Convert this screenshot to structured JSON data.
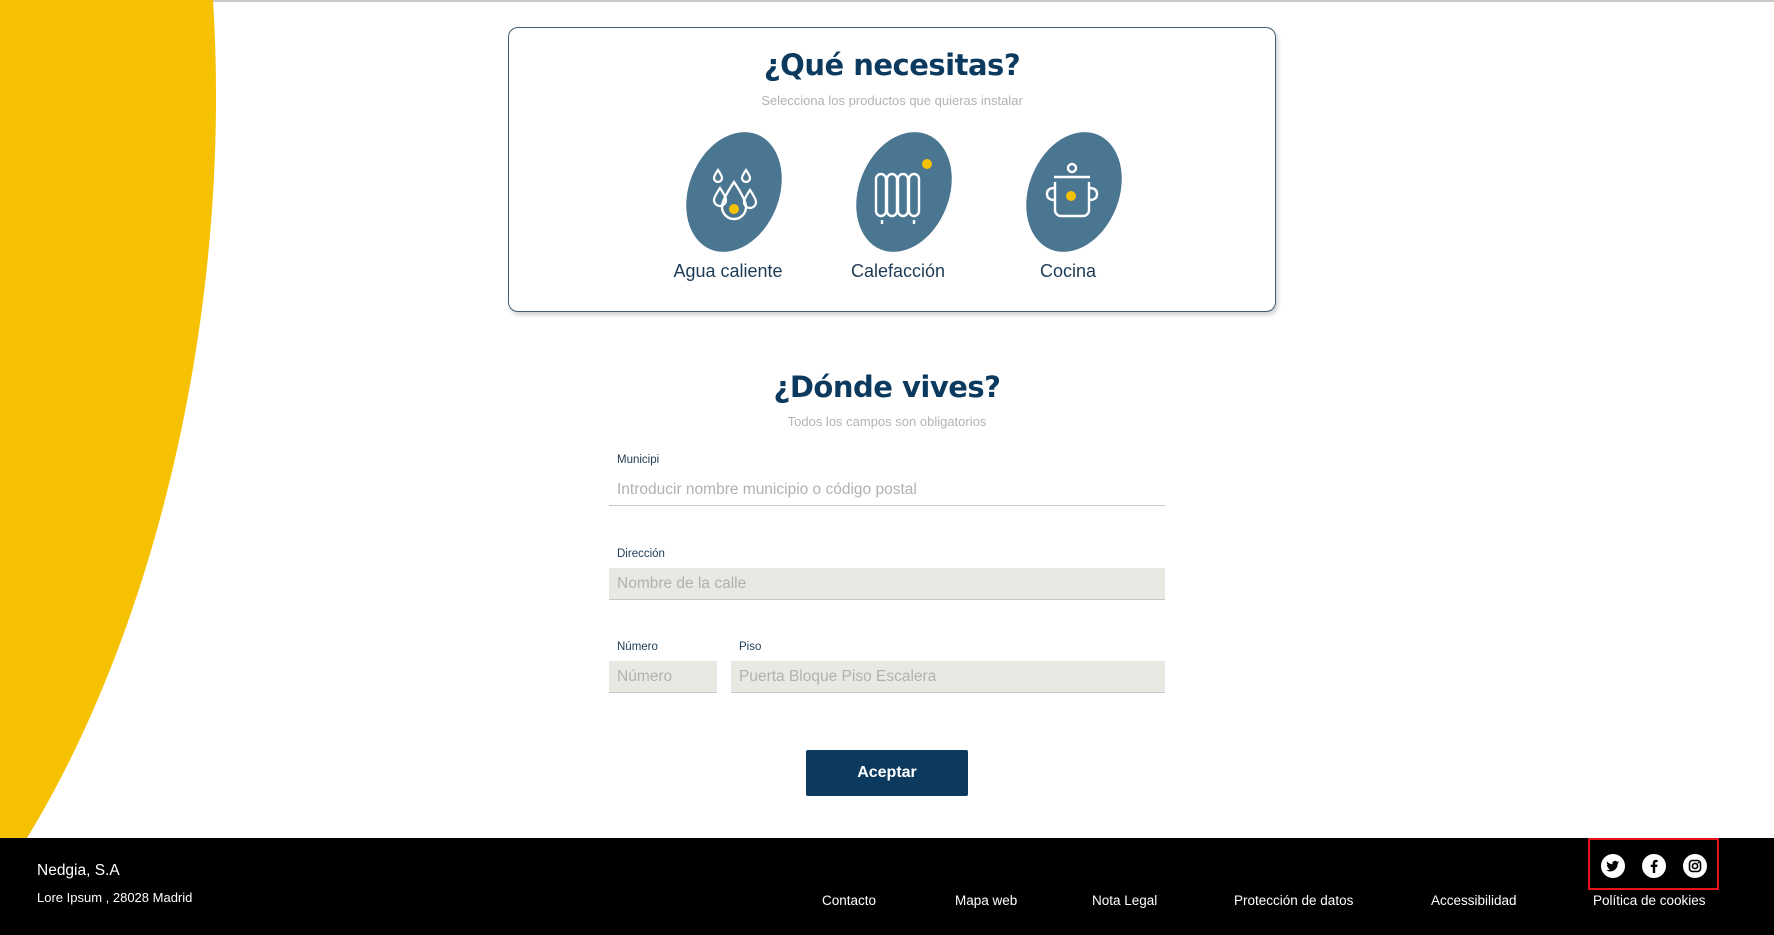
{
  "colors": {
    "accent_yellow": "#f6c100",
    "brand_navy": "#0c3a5e",
    "icon_blue": "#4a7691",
    "footer_bg": "#000000",
    "highlight_red": "#e3151a"
  },
  "needs": {
    "title": "¿Qué necesitas?",
    "subtitle": "Selecciona los productos que quieras instalar",
    "products": [
      {
        "label": "Agua caliente",
        "icon": "water-drops-icon"
      },
      {
        "label": "Calefacción",
        "icon": "radiator-icon"
      },
      {
        "label": "Cocina",
        "icon": "cooking-pot-icon"
      }
    ]
  },
  "address": {
    "title": "¿Dónde vives?",
    "subtitle": "Todos los campos son obligatorios",
    "municipio": {
      "label": "Municipi",
      "placeholder": "Introducir nombre municipio o código postal"
    },
    "direccion": {
      "label": "Dirección",
      "placeholder": "Nombre de la calle"
    },
    "numero": {
      "label": "Número",
      "placeholder": "Número"
    },
    "piso": {
      "label": "Piso",
      "placeholder": "Puerta Bloque Piso Escalera"
    },
    "accept_label": "Aceptar"
  },
  "footer": {
    "company_name": "Nedgia, S.A",
    "company_address": "Lore Ipsum , 28028 Madrid",
    "links": [
      "Contacto",
      "Mapa web",
      "Nota Legal",
      "Protección de datos",
      "Accessibilidad",
      "Política de cookies"
    ],
    "social": [
      "twitter-icon",
      "facebook-icon",
      "instagram-icon"
    ]
  }
}
